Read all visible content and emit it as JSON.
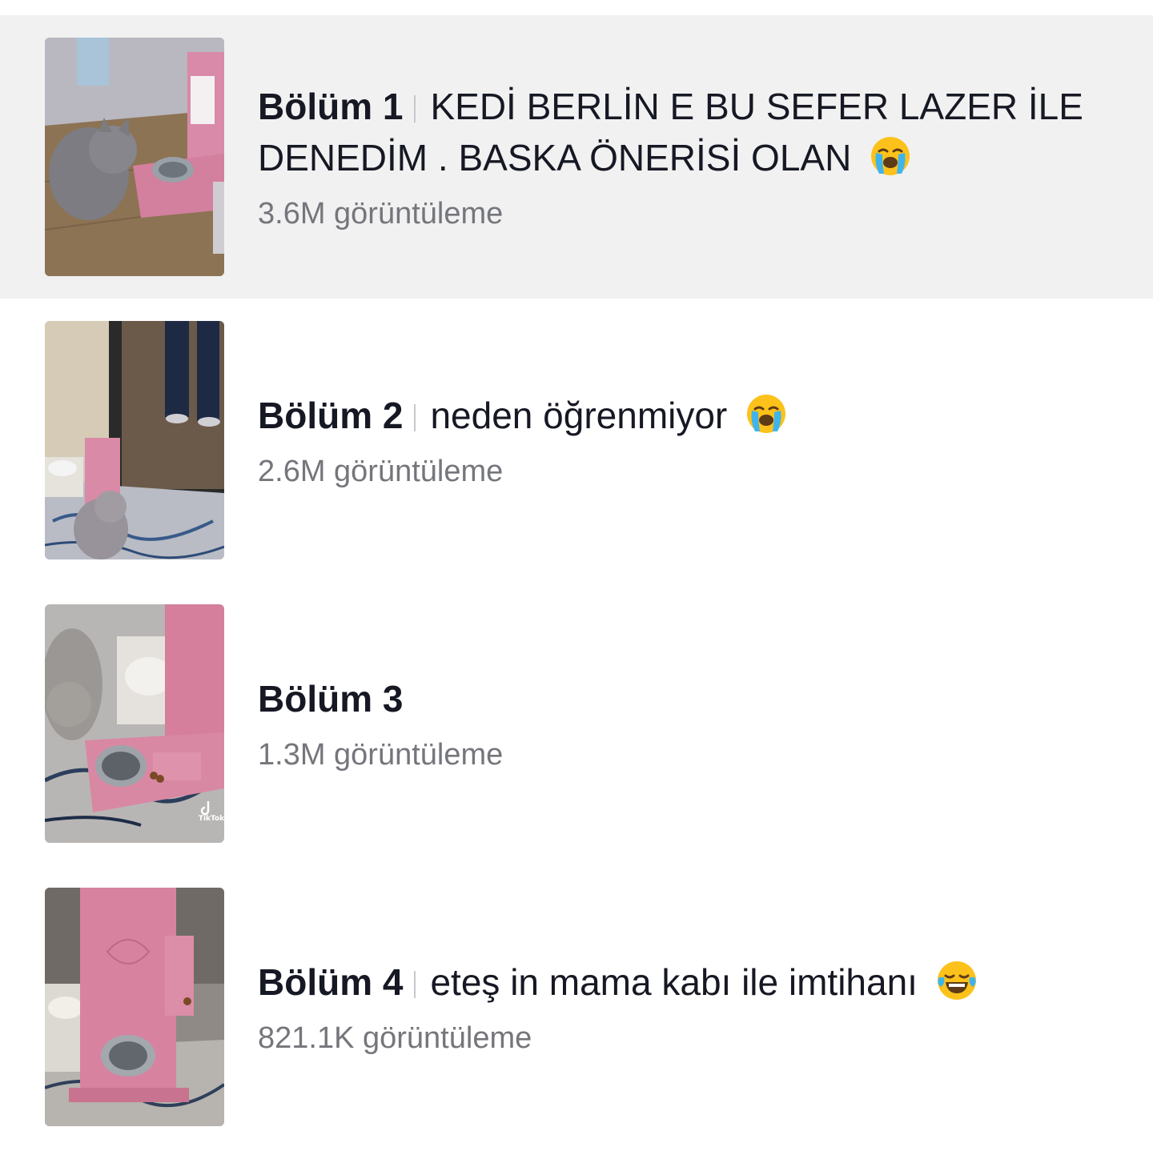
{
  "episodes": [
    {
      "label": "Bölüm 1",
      "title": "KEDİ BERLİN E BU SEFER LAZER İLE DENEDİM . BASKA ÖNERİSİ OLAN",
      "emoji": "crying-face-icon",
      "views": "3.6M görüntüleme",
      "active": true
    },
    {
      "label": "Bölüm 2",
      "title": "neden öğrenmiyor",
      "emoji": "crying-face-icon",
      "views": "2.6M görüntüleme",
      "active": false
    },
    {
      "label": "Bölüm 3",
      "title": "",
      "emoji": "",
      "views": "1.3M görüntüleme",
      "active": false
    },
    {
      "label": "Bölüm 4",
      "title": "eteş in mama kabı ile imtihanı",
      "emoji": "tears-of-joy-face-icon",
      "views": "821.1K görüntüleme",
      "active": false
    }
  ],
  "thumbnail_watermark": "TikTok"
}
